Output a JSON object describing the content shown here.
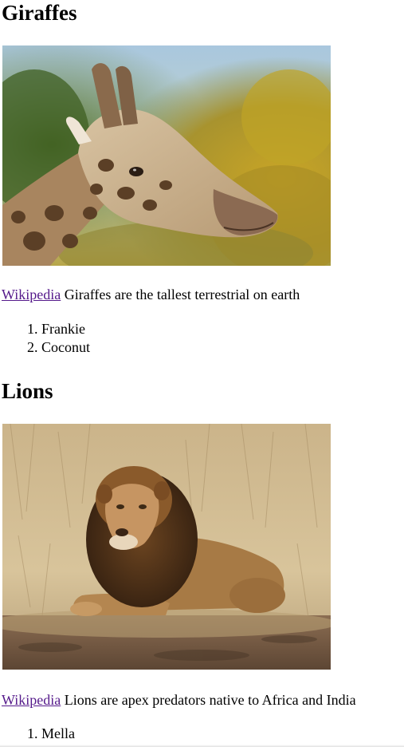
{
  "sections": [
    {
      "title": "Giraffes",
      "image_subject": "giraffe-photo",
      "link_label": "Wikipedia",
      "description": "Giraffes are the tallest terrestrial on earth",
      "list_items": [
        "Frankie",
        "Coconut"
      ]
    },
    {
      "title": "Lions",
      "image_subject": "lion-photo",
      "link_label": "Wikipedia",
      "description": "Lions are apex predators native to Africa and India",
      "list_items": [
        "Mella"
      ]
    }
  ],
  "colors": {
    "visited_link": "#551a8b",
    "text": "#000000",
    "background": "#ffffff"
  }
}
